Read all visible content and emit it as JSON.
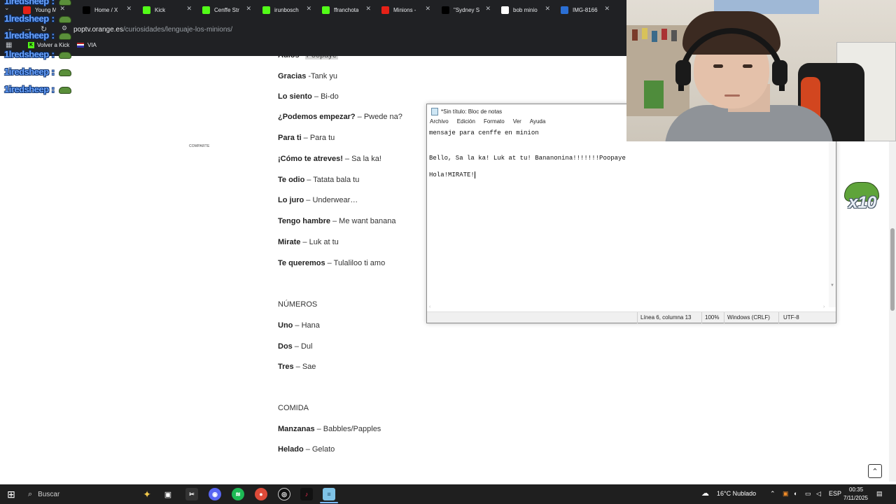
{
  "browser": {
    "tabs": [
      {
        "label": "Young Mi",
        "favicon": "youtube-icon",
        "color": "#e62117"
      },
      {
        "label": "Home / X",
        "favicon": "x-icon",
        "color": "#000000"
      },
      {
        "label": "Kick",
        "favicon": "kick-icon",
        "color": "#53fc18"
      },
      {
        "label": "Cenffe Str",
        "favicon": "kick-icon",
        "color": "#53fc18"
      },
      {
        "label": "irunbosch",
        "favicon": "kick-icon",
        "color": "#53fc18"
      },
      {
        "label": "ffranchota",
        "favicon": "kick-icon",
        "color": "#53fc18"
      },
      {
        "label": "Minions -",
        "favicon": "youtube-icon",
        "color": "#e62117"
      },
      {
        "label": "\"Sydney S",
        "favicon": "x-icon",
        "color": "#000000"
      },
      {
        "label": "bob minio",
        "favicon": "google-icon",
        "color": "#ffffff"
      },
      {
        "label": "IMG-8166",
        "favicon": "image-icon",
        "color": "#2b6fd4"
      }
    ],
    "url_host": "poptv.orange.es",
    "url_path": "/curiosidades/lenguaje-los-minions/",
    "bookmarks": [
      {
        "label": "Volver a Kick",
        "icon": "kick-icon"
      },
      {
        "label": "VIA",
        "icon": "flag-icon"
      }
    ]
  },
  "chat": {
    "username": "1lredsheep",
    "username_alt": "1iredsheep",
    "separator": ":"
  },
  "article": {
    "share_label": "COMPARTE",
    "phrases": [
      {
        "es": "Adiós",
        "mn": "Poopaye"
      },
      {
        "es": "Gracias",
        "mn": "-Tank yu"
      },
      {
        "es": "Lo siento",
        "mn": "– Bi-do"
      },
      {
        "es": "¿Podemos empezar?",
        "mn": "– Pwede na?"
      },
      {
        "es": "Para ti",
        "mn": "– Para tu"
      },
      {
        "es": "¡Cómo te atreves!",
        "mn": "– Sa la ka!"
      },
      {
        "es": "Te odio",
        "mn": "– Tatata bala tu"
      },
      {
        "es": "Lo juro",
        "mn": "– Underwear…"
      },
      {
        "es": "Tengo hambre",
        "mn": "– Me want banana"
      },
      {
        "es": "Mirate",
        "mn": "– Luk at tu"
      },
      {
        "es": "Te queremos",
        "mn": "– Tulaliloo ti amo"
      }
    ],
    "numbers_heading": "NÚMEROS",
    "numbers": [
      {
        "es": "Uno",
        "mn": "– Hana"
      },
      {
        "es": "Dos",
        "mn": "– Dul"
      },
      {
        "es": "Tres",
        "mn": "– Sae"
      }
    ],
    "food_heading": "COMIDA",
    "food": [
      {
        "es": "Manzanas",
        "mn": "– Babbles/Papples"
      },
      {
        "es": "Helado",
        "mn": "– Gelato"
      }
    ]
  },
  "emote": {
    "label": "x10"
  },
  "notepad": {
    "title": "*Sin título: Bloc de notas",
    "menu": [
      "Archivo",
      "Edición",
      "Formato",
      "Ver",
      "Ayuda"
    ],
    "lines": [
      "mensaje para cenffe en minion",
      "",
      "",
      "Bello, Sa la ka! Luk at tu! Bananonina!!!!!!!Poopaye",
      "",
      "Hola!MIRATE!"
    ],
    "status": {
      "position": "Línea 6, columna 13",
      "zoom": "100%",
      "line_endings": "Windows (CRLF)",
      "encoding": "UTF-8"
    }
  },
  "taskbar": {
    "search_placeholder": "Buscar",
    "weather": "16°C  Nublado",
    "language": "ESP",
    "time": "00:35",
    "date": "7/11/2025"
  }
}
